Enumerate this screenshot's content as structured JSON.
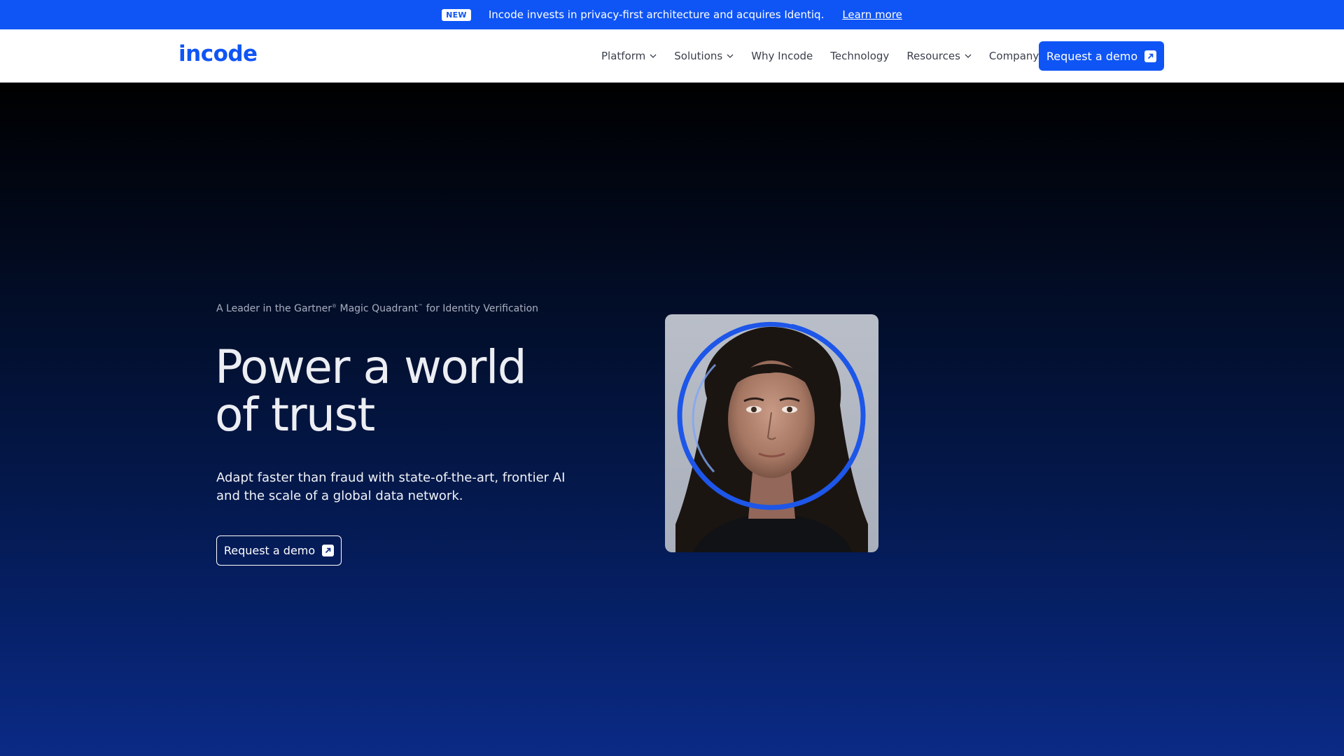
{
  "announcement": {
    "badge": "NEW",
    "text": "Incode invests in privacy-first architecture and acquires Identiq.",
    "link": "Learn more"
  },
  "nav": {
    "logo": "incode",
    "items": [
      {
        "label": "Platform",
        "dropdown": true
      },
      {
        "label": "Solutions",
        "dropdown": true
      },
      {
        "label": "Why Incode",
        "dropdown": false
      },
      {
        "label": "Technology",
        "dropdown": false
      },
      {
        "label": "Resources",
        "dropdown": true
      },
      {
        "label": "Company",
        "dropdown": true
      }
    ],
    "cta": "Request a demo"
  },
  "hero": {
    "eyebrow_pre": "A Leader in the Gartner",
    "eyebrow_mid": " Magic Quadrant",
    "eyebrow_post": "  for Identity Verification",
    "reg_mark": "®",
    "tm_mark": "™",
    "headline_line1": "Power a world",
    "headline_line2": "of trust",
    "subtext": "Adapt faster than fraud with state-of-the-art, frontier AI and the scale of a global data network.",
    "cta": "Request a demo"
  },
  "colors": {
    "brand": "#0f55f5",
    "announce_bg": "#0f55f5",
    "hero_top": "#000000",
    "hero_bottom": "#0a2a86"
  }
}
